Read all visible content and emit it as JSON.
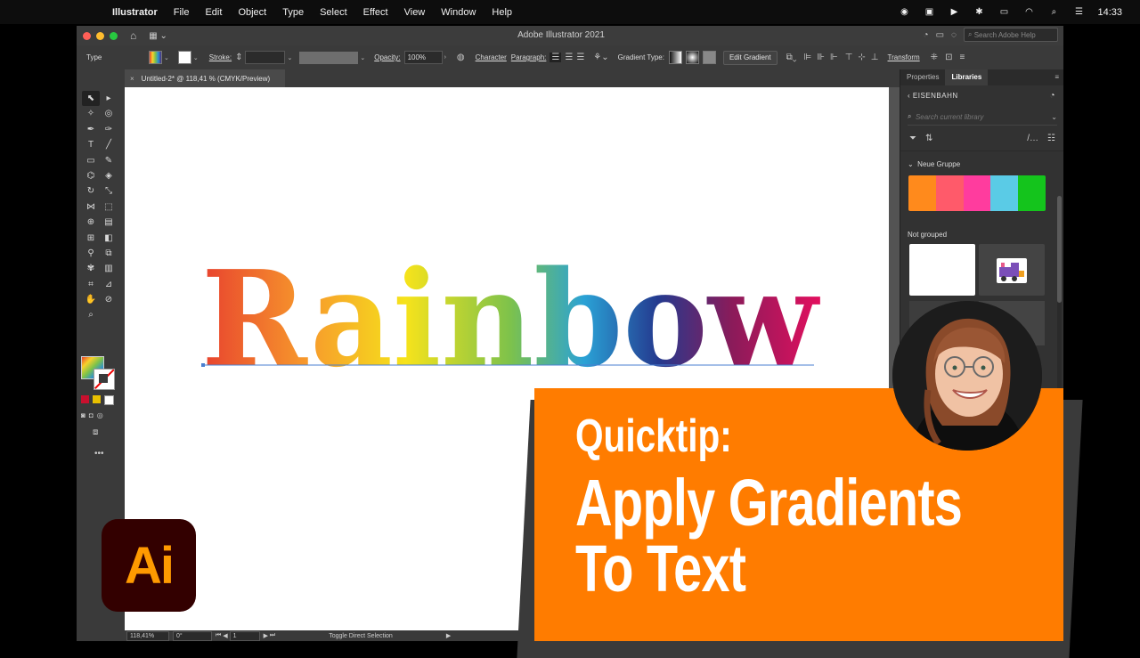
{
  "menubar": {
    "items": [
      "Illustrator",
      "File",
      "Edit",
      "Object",
      "Type",
      "Select",
      "Effect",
      "View",
      "Window",
      "Help"
    ],
    "time": "14:33"
  },
  "window": {
    "title": "Adobe Illustrator 2021",
    "help_placeholder": "Search Adobe Help"
  },
  "control_bar": {
    "selection_type": "Type",
    "stroke_label": "Stroke:",
    "opacity_label": "Opacity:",
    "opacity_value": "100%",
    "character_label": "Character",
    "paragraph_label": "Paragraph:",
    "gradient_type_label": "Gradient Type:",
    "edit_gradient_label": "Edit Gradient",
    "transform_label": "Transform"
  },
  "document": {
    "tab_label": "Untitled-2* @ 118,41 % (CMYK/Preview)",
    "artwork_text": "Rainbow",
    "zoom": "118,41%",
    "rotation": "0°",
    "artboard_number": "1",
    "status_text": "Toggle Direct Selection"
  },
  "right_panel": {
    "tabs": [
      "Properties",
      "Libraries"
    ],
    "active_tab": "Libraries",
    "library_name": "EISENBAHN",
    "search_placeholder": "Search current library",
    "group_name": "Neue Gruppe",
    "swatches": [
      "#ff8a1c",
      "#ff5a6a",
      "#ff3c9e",
      "#5acbe6",
      "#14c41c"
    ],
    "ungrouped_label": "Not grouped"
  },
  "overlay": {
    "logo_text": "Ai",
    "banner_line1": "Quicktip:",
    "banner_line2": "Apply Gradients",
    "banner_line3": "To Text",
    "banner_color": "#ff7c00"
  }
}
